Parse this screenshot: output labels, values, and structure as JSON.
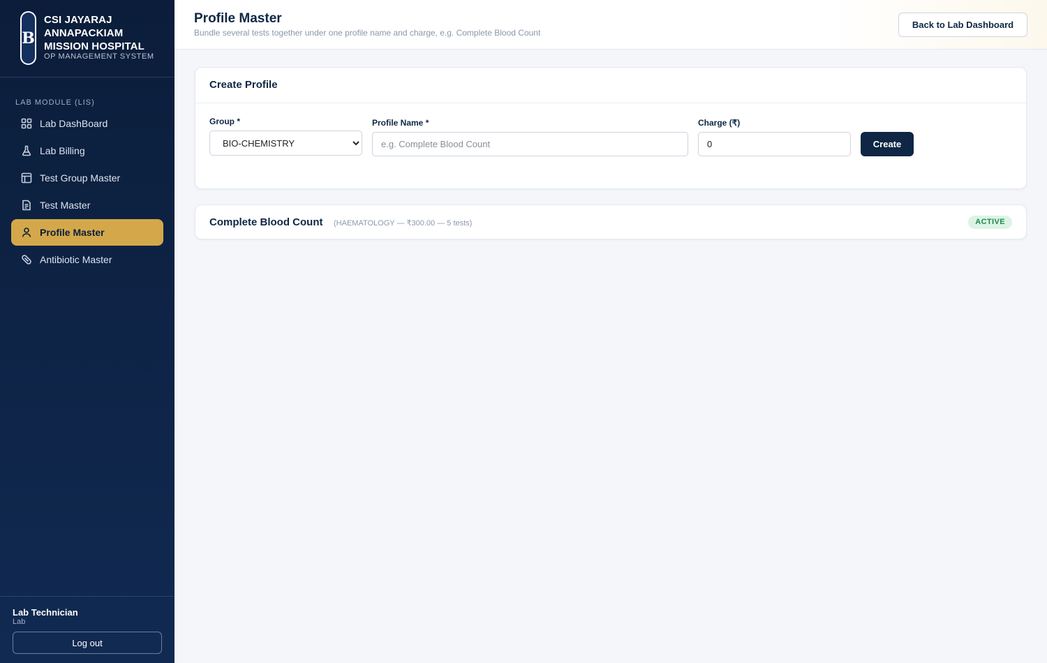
{
  "brand": {
    "logo_letter": "B",
    "name": "CSI JAYARAJ ANNAPACKIAM MISSION HOSPITAL",
    "subtitle": "OP MANAGEMENT SYSTEM"
  },
  "sidebar": {
    "section_label": "LAB MODULE (LIS)",
    "items": [
      {
        "label": "Lab DashBoard",
        "icon": "grid-icon"
      },
      {
        "label": "Lab Billing",
        "icon": "flask-icon"
      },
      {
        "label": "Test Group Master",
        "icon": "layout-icon"
      },
      {
        "label": "Test Master",
        "icon": "document-icon"
      },
      {
        "label": "Profile Master",
        "icon": "user-icon",
        "active": true
      },
      {
        "label": "Antibiotic Master",
        "icon": "pill-icon"
      }
    ],
    "user": {
      "name": "Lab Technician",
      "role": "Lab"
    },
    "logout_label": "Log out"
  },
  "header": {
    "title": "Profile Master",
    "subtitle": "Bundle several tests together under one profile name and charge, e.g. Complete Blood Count",
    "back_label": "Back to Lab Dashboard"
  },
  "create_form": {
    "title": "Create Profile",
    "group_label": "Group *",
    "group_value": "BIO-CHEMISTRY",
    "profile_name_label": "Profile Name *",
    "profile_name_placeholder": "e.g. Complete Blood Count",
    "charge_label": "Charge (₹)",
    "charge_value": "0",
    "create_label": "Create"
  },
  "profiles": [
    {
      "name": "Complete Blood Count",
      "meta": "(HAEMATOLOGY — ₹300.00 — 5 tests)",
      "status": "ACTIVE"
    }
  ],
  "colors": {
    "sidebar_bg": "#0b1d3a",
    "accent": "#d4a84a",
    "primary": "#0f2744",
    "badge_bg": "#dcf3e6",
    "badge_text": "#1f8a4c"
  }
}
